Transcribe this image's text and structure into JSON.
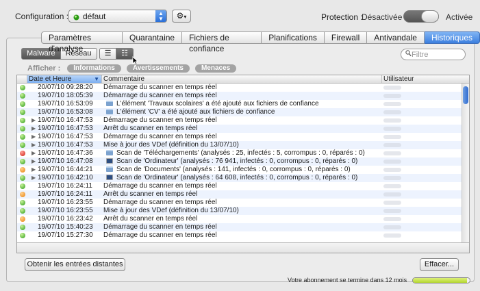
{
  "config": {
    "label": "Configuration :",
    "value": "défaut"
  },
  "protection": {
    "label": "Protection :",
    "state": "Désactivée",
    "alt_state": "Activée"
  },
  "tabs": [
    {
      "label": "Paramètres d'analyse"
    },
    {
      "label": "Quarantaine"
    },
    {
      "label": "Fichiers de confiance"
    },
    {
      "label": "Planifications"
    },
    {
      "label": "Firewall"
    },
    {
      "label": "Antivandale"
    },
    {
      "label": "Historiques",
      "active": true
    }
  ],
  "source_toggle": {
    "malware": "Malware",
    "reseau": "Réseau"
  },
  "search": {
    "placeholder": "Filtre"
  },
  "filter": {
    "label": "Afficher :",
    "pills": [
      "Informations",
      "Avertissements",
      "Menaces"
    ]
  },
  "table": {
    "headers": {
      "date": "Date et Heure",
      "comment": "Commentaire",
      "user": "Utilisateur"
    },
    "rows": [
      {
        "status": "green",
        "date": "20/07/10 09:28:20",
        "comment": "Démarrage du scanner en temps réel"
      },
      {
        "status": "green",
        "date": "19/07/10 18:05:39",
        "comment": "Démarrage du scanner en temps réel"
      },
      {
        "status": "green",
        "date": "19/07/10 16:53:09",
        "icon": "folder",
        "comment": "L'élément 'Travaux scolaires' a été ajouté aux fichiers de confiance"
      },
      {
        "status": "green",
        "date": "19/07/10 16:53:08",
        "icon": "folder",
        "comment": "L'élément 'CV' a été ajouté aux fichiers de confiance"
      },
      {
        "status": "green",
        "disclosure": true,
        "date": "19/07/10 16:47:53",
        "comment": "Démarrage du scanner en temps réel"
      },
      {
        "status": "green",
        "disclosure": true,
        "date": "19/07/10 16:47:53",
        "comment": "Arrêt du scanner en temps réel"
      },
      {
        "status": "green",
        "disclosure": true,
        "date": "19/07/10 16:47:53",
        "comment": "Démarrage du scanner en temps réel"
      },
      {
        "status": "green",
        "disclosure": true,
        "date": "19/07/10 16:47:53",
        "comment": "Mise à jour des VDef (définition du 13/07/10)"
      },
      {
        "status": "red",
        "disclosure": true,
        "date": "19/07/10 16:47:36",
        "icon": "folder",
        "comment": "Scan de 'Téléchargements' (analysés : 25, infectés : 5, corrompus : 0, réparés : 0)"
      },
      {
        "status": "green",
        "disclosure": true,
        "date": "19/07/10 16:47:08",
        "icon": "monitor",
        "comment": "Scan de 'Ordinateur' (analysés : 76 941, infectés : 0, corrompus : 0, réparés : 0)"
      },
      {
        "status": "orange",
        "disclosure": true,
        "date": "19/07/10 16:44:21",
        "icon": "folder",
        "comment": "Scan de 'Documents' (analysés : 141, infectés : 0, corrompus : 0, réparés : 0)"
      },
      {
        "status": "green",
        "disclosure": true,
        "date": "19/07/10 16:42:10",
        "icon": "monitor",
        "comment": "Scan de 'Ordinateur' (analysés : 64 608, infectés : 0, corrompus : 0, réparés : 0)"
      },
      {
        "status": "green",
        "date": "19/07/10 16:24:11",
        "comment": "Démarrage du scanner en temps réel"
      },
      {
        "status": "orange",
        "date": "19/07/10 16:24:11",
        "comment": "Arrêt du scanner en temps réel"
      },
      {
        "status": "green",
        "date": "19/07/10 16:23:55",
        "comment": "Démarrage du scanner en temps réel"
      },
      {
        "status": "green",
        "date": "19/07/10 16:23:55",
        "comment": "Mise à jour des VDef (définition du 13/07/10)"
      },
      {
        "status": "orange",
        "date": "19/07/10 16:23:42",
        "comment": "Arrêt du scanner en temps réel"
      },
      {
        "status": "green",
        "date": "19/07/10 15:40:23",
        "comment": "Démarrage du scanner en temps réel"
      },
      {
        "status": "green",
        "date": "19/07/10 15:27:30",
        "comment": "Démarrage du scanner en temps réel"
      }
    ]
  },
  "buttons": {
    "remote": "Obtenir les entrées distantes",
    "clear": "Effacer..."
  },
  "subscription": {
    "text": "Votre abonnement se termine dans 12 mois",
    "fill_fraction": 0.95
  },
  "colors": {
    "accent": "#3c7fdf",
    "green": "#2b9b17",
    "red": "#cf1d12",
    "orange": "#e8800d"
  }
}
